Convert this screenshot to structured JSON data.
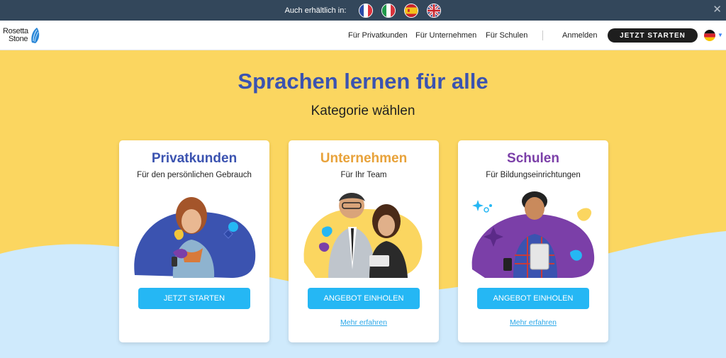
{
  "langbar": {
    "text": "Auch erhältlich in:",
    "flags": [
      "france-flag-icon",
      "italy-flag-icon",
      "spain-flag-icon",
      "uk-flag-icon"
    ],
    "close_icon": "close-icon"
  },
  "nav": {
    "logo_line1": "Rosetta",
    "logo_line2": "Stone",
    "links": [
      "Für Privatkunden",
      "Für Unternehmen",
      "Für Schulen"
    ],
    "login": "Anmelden",
    "cta": "JETZT STARTEN",
    "language_icon": "germany-flag-icon"
  },
  "hero": {
    "title": "Sprachen lernen für alle",
    "subtitle": "Kategorie wählen"
  },
  "cards": [
    {
      "title": "Privatkunden",
      "subtitle": "Für den persönlichen Gebrauch",
      "button": "JETZT STARTEN",
      "link": "",
      "title_color": "#3b53b0"
    },
    {
      "title": "Unternehmen",
      "subtitle": "Für Ihr Team",
      "button": "ANGEBOT EINHOLEN",
      "link": "Mehr erfahren",
      "title_color": "#e8a23a"
    },
    {
      "title": "Schulen",
      "subtitle": "Für Bildungseinrichtungen",
      "button": "ANGEBOT EINHOLEN",
      "link": "Mehr erfahren",
      "title_color": "#7b3fa8"
    }
  ],
  "colors": {
    "topbar": "#33475b",
    "hero_yellow": "#fbd660",
    "hero_blue": "#cfeafc",
    "button_blue": "#25b7f4",
    "headline_blue": "#3b53b0"
  }
}
